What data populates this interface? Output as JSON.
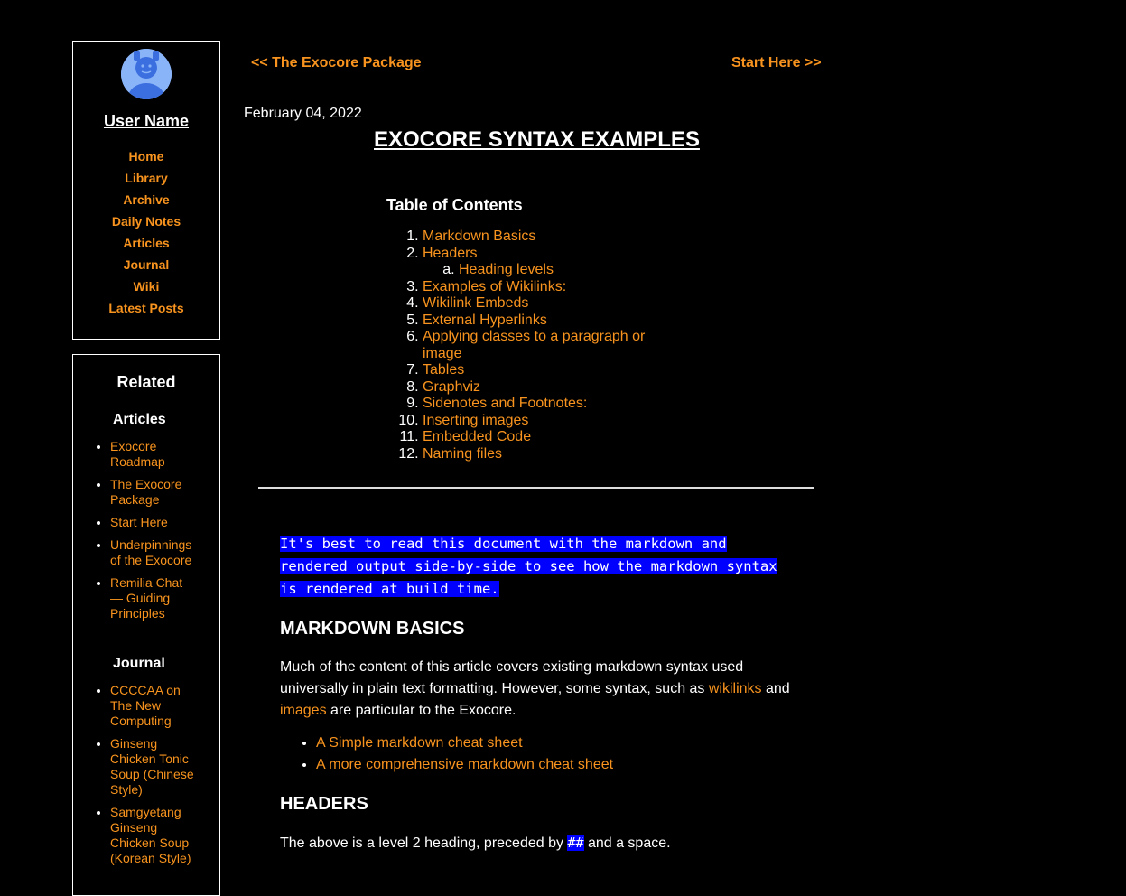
{
  "sidebar": {
    "user_name": "User Name",
    "nav": [
      "Home",
      "Library",
      "Archive",
      "Daily Notes",
      "Articles",
      "Journal",
      "Wiki",
      "Latest Posts"
    ]
  },
  "related": {
    "title": "Related",
    "articles_heading": "Articles",
    "articles": [
      "Exocore Roadmap",
      "The Exocore Package",
      "Start Here",
      "Underpinnings of the Exocore",
      "Remilia Chat — Guiding Principles"
    ],
    "journal_heading": "Journal",
    "journal": [
      "CCCCAA on The New Computing",
      "Ginseng Chicken Tonic Soup (Chinese Style)",
      "Samgyetang Ginseng Chicken Soup (Korean Style)"
    ]
  },
  "pager": {
    "prev": "<< The Exocore Package",
    "next": "Start Here >>"
  },
  "post": {
    "date": "February 04, 2022",
    "title": "EXOCORE SYNTAX EXAMPLES"
  },
  "toc": {
    "title": "Table of Contents",
    "items": [
      "Markdown Basics",
      "Headers",
      "Examples of Wikilinks:",
      "Wikilink Embeds",
      "External Hyperlinks",
      "Applying classes to a paragraph or image",
      "Tables",
      "Graphviz",
      "Sidenotes and Footnotes:",
      "Inserting images",
      "Embedded Code",
      "Naming files"
    ],
    "sub_items": [
      "Heading levels"
    ]
  },
  "content": {
    "intro": "It's best to read this document with the markdown and rendered output side-by-side to see how the markdown syntax is rendered at build time.",
    "markdown_heading": "MARKDOWN BASICS",
    "markdown_para_1": "Much of the content of this article covers existing markdown syntax used universally in plain text formatting. However, some syntax, such as ",
    "markdown_link_wikilinks": "wikilinks",
    "markdown_para_2": " and ",
    "markdown_link_images": "images",
    "markdown_para_3": " are particular to the Exocore.",
    "cheat_sheets": [
      "A Simple markdown cheat sheet",
      "A more comprehensive markdown cheat sheet"
    ],
    "headers_heading": "HEADERS",
    "headers_para_1": "The above is a level 2 heading, preceded by ",
    "headers_code": "##",
    "headers_para_2": " and a space."
  },
  "colors": {
    "background": "#000000",
    "link": "#f7931e",
    "code_highlight": "#0000ff",
    "avatar": "#8ab4f8"
  }
}
